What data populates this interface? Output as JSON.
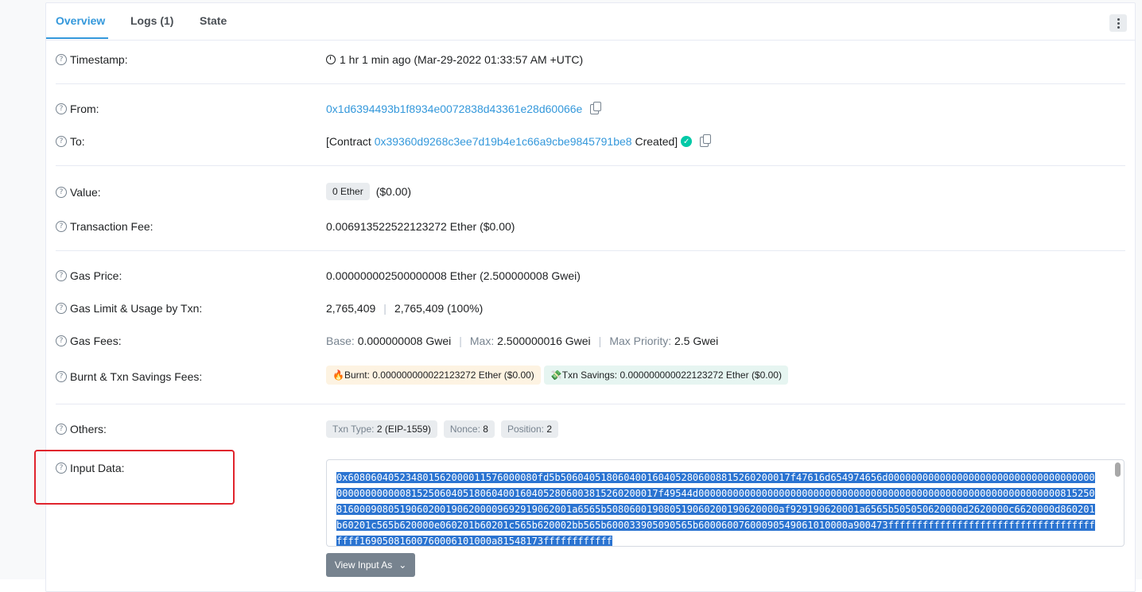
{
  "tabs": [
    {
      "label": "Overview"
    },
    {
      "label": "Logs (1)"
    },
    {
      "label": "State"
    }
  ],
  "fields": {
    "timestamp": {
      "label": "Timestamp:",
      "value": "1 hr 1 min ago (Mar-29-2022 01:33:57 AM +UTC)"
    },
    "from": {
      "label": "From:",
      "value": "0x1d6394493b1f8934e0072838d43361e28d60066e"
    },
    "to": {
      "label": "To:",
      "prefix": "[Contract",
      "address": "0x39360d9268c3ee7d19b4e1c66a9cbe9845791be8",
      "suffix": "Created]"
    },
    "value": {
      "label": "Value:",
      "amount": "0 Ether",
      "usd": "($0.00)"
    },
    "txn_fee": {
      "label": "Transaction Fee:",
      "value": "0.006913522522123272 Ether ($0.00)"
    },
    "gas_price": {
      "label": "Gas Price:",
      "value": "0.000000002500000008 Ether (2.500000008 Gwei)"
    },
    "gas_limit": {
      "label": "Gas Limit & Usage by Txn:",
      "limit": "2,765,409",
      "usage": "2,765,409 (100%)"
    },
    "gas_fees": {
      "label": "Gas Fees:",
      "base_label": "Base:",
      "base": "0.000000008 Gwei",
      "max_label": "Max:",
      "max": "2.500000016 Gwei",
      "priority_label": "Max Priority:",
      "priority": "2.5 Gwei"
    },
    "burnt": {
      "label": "Burnt & Txn Savings Fees:",
      "burnt": "🔥Burnt: 0.000000000022123272 Ether ($0.00)",
      "savings": "💸Txn Savings: 0.000000000022123272 Ether ($0.00)"
    },
    "others": {
      "label": "Others:",
      "type_label": "Txn Type:",
      "type": "2 (EIP-1559)",
      "nonce_label": "Nonce:",
      "nonce": "8",
      "position_label": "Position:",
      "position": "2"
    },
    "input": {
      "label": "Input Data:",
      "data": "0x608060405234801562000011576000080fd5b5060405180604001604052806008815260200017f47616d654974656d00000000000000000000000000000000000000000000000081525060405180604001604052806003815260200017f49544d00000000000000000000000000000000000000000000000000000000000000081525081600090805190602001906200009692919062001a6565b508060019080519060200190620000af929190620001a6565b505050620000d2620000c6620000d860201b60201c565b620000e060201b60201c565b620002bb565b600033905090565b60006007600090549061010000a900473ffffffffffffffffffffffffffffffffffffffff16905081600760006101000a81548173ffffffffffff",
      "button": "View Input As"
    }
  },
  "colors": {
    "accent": "#3498db",
    "success": "#00c9a7",
    "highlight": "#e0242d"
  }
}
